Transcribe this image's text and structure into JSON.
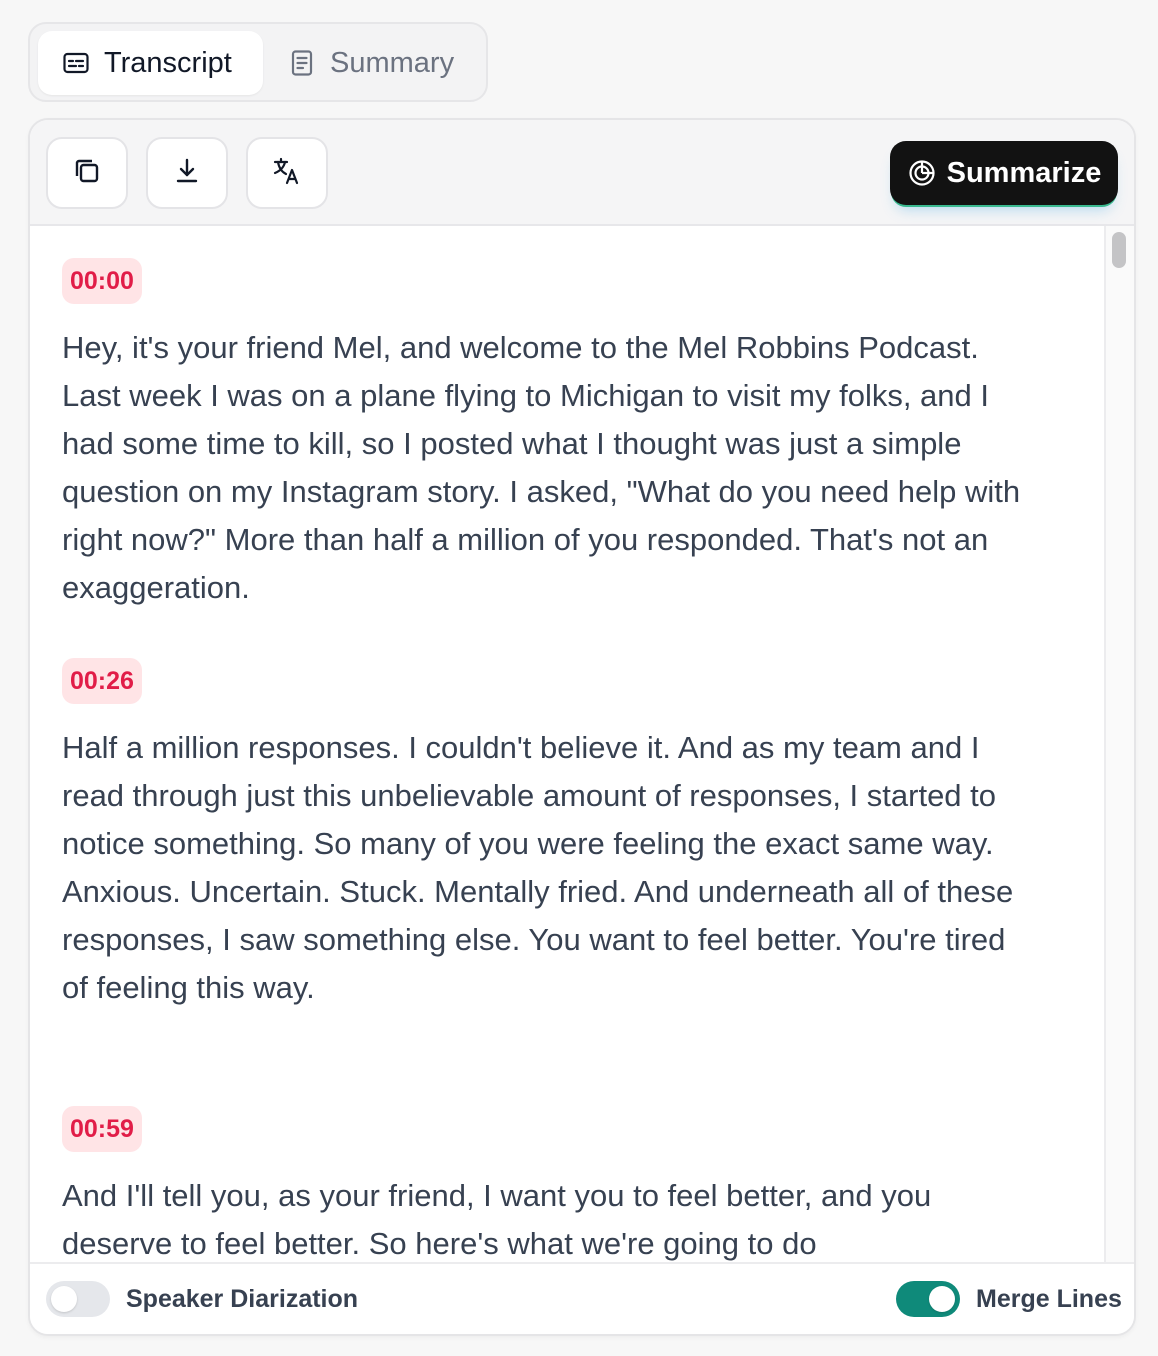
{
  "tabs": [
    {
      "label": "Transcript",
      "icon": "captions-icon",
      "active": true
    },
    {
      "label": "Summary",
      "icon": "document-icon",
      "active": false
    }
  ],
  "toolbar": {
    "copy_icon": "copy-icon",
    "download_icon": "download-icon",
    "translate_icon": "translate-icon",
    "summarize_label": "Summarize",
    "summarize_icon": "openai-icon"
  },
  "segments": [
    {
      "time": "00:00",
      "text": "Hey, it's your friend Mel, and welcome to the Mel Robbins Podcast. Last week I was on a plane flying to Michigan to visit my folks, and I had some time to kill, so I posted what I thought was just a simple question on my Instagram story. I asked, \"What do you need help with right now?\" More than half a million of you responded. That's not an exaggeration."
    },
    {
      "time": "00:26",
      "text": "Half a million responses. I couldn't believe it. And as my team and I read through just this unbelievable amount of responses, I started to notice something. So many of you were feeling the exact same way. Anxious. Uncertain. Stuck. Mentally fried. And underneath all of these responses, I saw something else. You want to feel better. You're tired of feeling this way."
    },
    {
      "time": "00:59",
      "text": "And I'll tell you, as your friend, I want you to feel better, and you deserve to feel better. So here's what we're going to do"
    }
  ],
  "footer": {
    "speaker_diarization_label": "Speaker Diarization",
    "speaker_diarization_on": false,
    "merge_lines_label": "Merge Lines",
    "merge_lines_on": true
  },
  "colors": {
    "timestamp_bg": "#ffe4e6",
    "timestamp_text": "#e11d48",
    "toggle_on": "#0f8a7a",
    "summarize_bg": "#121212"
  }
}
